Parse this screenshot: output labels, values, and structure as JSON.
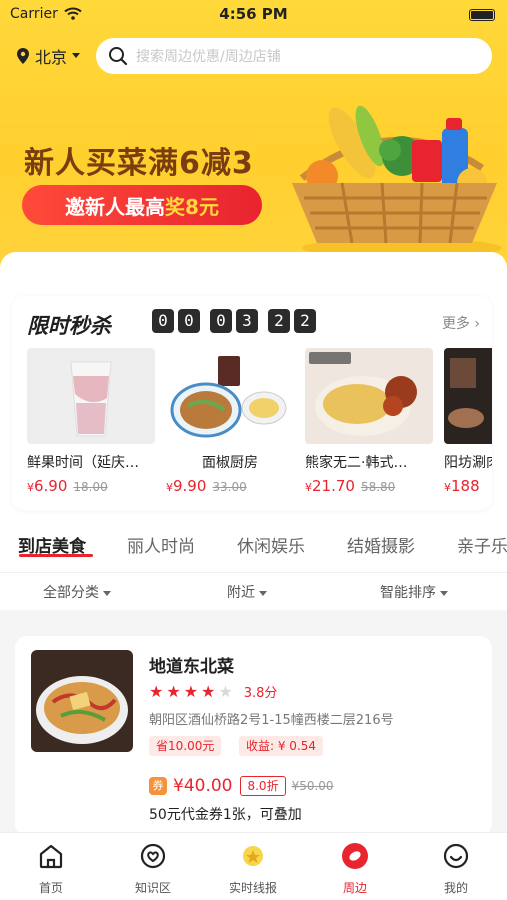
{
  "status_bar": {
    "carrier": "Carrier",
    "time": "4:56 PM"
  },
  "header": {
    "city": "北京",
    "search_placeholder": "搜索周边优惠/周边店铺"
  },
  "banner": {
    "headline": "新人买菜满6减3",
    "sub_prefix": "邀新人最高",
    "sub_highlight": "奖8元"
  },
  "flash_sale": {
    "title": "限时秒杀",
    "timer_digits": [
      "0",
      "0",
      "0",
      "3",
      "2",
      "2"
    ],
    "more_label": "更多",
    "products": [
      {
        "name": "鲜果时间（延庆…",
        "currency": "¥",
        "price": "6.90",
        "original": "18.00"
      },
      {
        "name": "面椒厨房",
        "currency": "¥",
        "price": "9.90",
        "original": "33.00"
      },
      {
        "name": "熊家无二·韩式…",
        "currency": "¥",
        "price": "21.70",
        "original": "58.80"
      },
      {
        "name": "阳坊涮肉",
        "currency": "¥",
        "price": "188",
        "original": ""
      }
    ]
  },
  "category_tabs": [
    "到店美食",
    "丽人时尚",
    "休闲娱乐",
    "结婚摄影",
    "亲子乐园"
  ],
  "filters": [
    "全部分类",
    "附近",
    "智能排序"
  ],
  "shop": {
    "name": "地道东北菜",
    "rating_stars": 4,
    "rating_max": 5,
    "score": "3.8分",
    "address": "朝阳区酒仙桥路2号1-15幢西楼二层216号",
    "tag_save": "省10.00元",
    "tag_income": "收益: ¥ 0.54",
    "coupon_icon": "券",
    "coupon_price": "¥40.00",
    "coupon_discount": "8.0折",
    "coupon_original": "¥50.00",
    "coupon_desc": "50元代金券1张，可叠加"
  },
  "tab_bar": [
    {
      "label": "首页",
      "icon": "home-icon"
    },
    {
      "label": "知识区",
      "icon": "knowledge-icon"
    },
    {
      "label": "实时线报",
      "icon": "news-icon"
    },
    {
      "label": "周边",
      "icon": "nearby-icon"
    },
    {
      "label": "我的",
      "icon": "profile-icon"
    }
  ],
  "colors": {
    "accent": "#e8242f",
    "banner_yellow": "#ffd43f",
    "orange": "#f6923a"
  }
}
